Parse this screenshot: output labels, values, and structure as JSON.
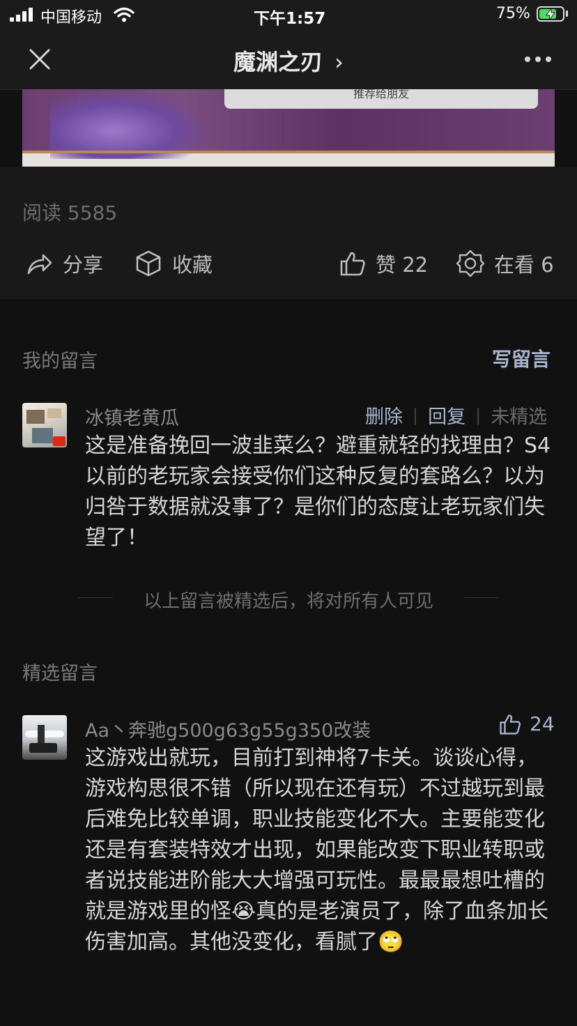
{
  "status_bar": {
    "carrier": "中国移动",
    "time": "下午1:57",
    "battery_percent": "75%",
    "battery_level": 0.75
  },
  "nav": {
    "title": "魔渊之刃",
    "title_chevron": "›"
  },
  "banner": {
    "button_text": "推荐给朋友"
  },
  "article": {
    "read_label": "阅读 5585",
    "share_label": "分享",
    "favorite_label": "收藏",
    "like_label": "赞 22",
    "watching_label": "在看 6"
  },
  "my_comments": {
    "title": "我的留言",
    "write_label": "写留言",
    "comment": {
      "author": "冰镇老黄瓜",
      "delete_label": "删除",
      "reply_label": "回复",
      "status_label": "未精选",
      "text": "这是准备挽回一波韭菜么？避重就轻的找理由？S4以前的老玩家会接受你们这种反复的套路么？以为归咎于数据就没事了？是你们的态度让老玩家们失望了！"
    },
    "notice": "以上留言被精选后，将对所有人可见"
  },
  "featured": {
    "title": "精选留言",
    "comment": {
      "author": "Aa丶奔驰g500g63g55g350改装",
      "likes": "24",
      "text": "这游戏出就玩，目前打到神将7卡关。谈谈心得，游戏构思很不错（所以现在还有玩）不过越玩到最后难免比较单调，职业技能变化不大。主要能变化还是有套装特效才出现，如果能改变下职业转职或者说技能进阶能大大增强可玩性。最最最想吐槽的就是游戏里的怪",
      "text_emoji_1": "😭",
      "text_part2": "真的是老演员了，除了血条加长伤害加高。其他没变化，看腻了",
      "text_emoji_2": "🙄"
    }
  },
  "colors": {
    "background": "#111111",
    "accent_link": "#a9b6cf",
    "battery_green": "#4cd964"
  },
  "icons": [
    "signal-icon",
    "wifi-icon",
    "battery-icon",
    "close-icon",
    "more-icon",
    "share-icon",
    "favorite-icon",
    "like-icon",
    "watching-icon",
    "flag-icon"
  ]
}
